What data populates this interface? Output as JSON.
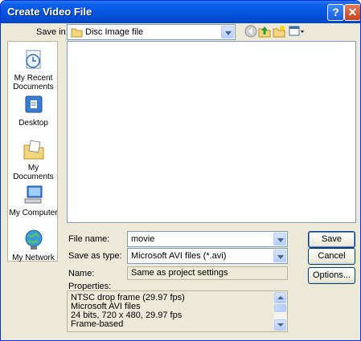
{
  "window": {
    "title": "Create Video File",
    "help_glyph": "?",
    "close_glyph": "✕"
  },
  "save_in": {
    "label": "Save in:",
    "value": "Disc Image file"
  },
  "toolbar": {
    "back_icon": "back-arrow-icon",
    "up_icon": "up-folder-icon",
    "new_folder_icon": "new-folder-icon",
    "views_icon": "views-menu-icon"
  },
  "places": [
    {
      "label_line1": "My Recent",
      "label_line2": "Documents",
      "icon": "recent-documents-icon"
    },
    {
      "label_line1": "Desktop",
      "label_line2": "",
      "icon": "desktop-icon"
    },
    {
      "label_line1": "My Documents",
      "label_line2": "",
      "icon": "my-documents-icon"
    },
    {
      "label_line1": "My Computer",
      "label_line2": "",
      "icon": "my-computer-icon"
    },
    {
      "label_line1": "My Network",
      "label_line2": "",
      "icon": "my-network-icon"
    }
  ],
  "file_name": {
    "label": "File name:",
    "value": "movie"
  },
  "save_as_type": {
    "label": "Save as type:",
    "value": "Microsoft AVI files (*.avi)"
  },
  "name_field": {
    "label": "Name:",
    "value": "Same as project settings"
  },
  "properties": {
    "label": "Properties:",
    "lines": [
      "NTSC drop frame (29.97 fps)",
      "Microsoft AVI files",
      "24 bits, 720 x 480, 29.97 fps",
      "Frame-based"
    ]
  },
  "buttons": {
    "save": "Save",
    "cancel": "Cancel",
    "options": "Options..."
  }
}
